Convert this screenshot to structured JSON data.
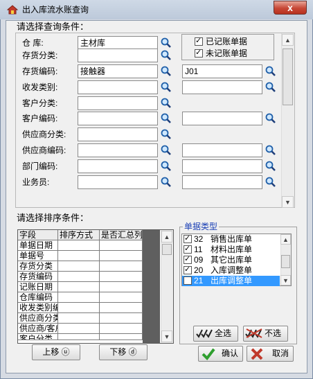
{
  "window": {
    "title": "出入库流水账查询",
    "close_symbol": "x"
  },
  "query": {
    "section_label": "请选择查询条件：",
    "rows": [
      {
        "label": "仓    库:",
        "value": "主材库",
        "value2": null
      },
      {
        "label": "存货分类:",
        "value": "",
        "value2": null
      },
      {
        "label": "存货编码:",
        "value": "接触器",
        "value2": "J01"
      },
      {
        "label": "收发类别:",
        "value": "",
        "value2": ""
      },
      {
        "label": "客户分类:",
        "value": "",
        "value2": null
      },
      {
        "label": "客户编码:",
        "value": "",
        "value2": ""
      },
      {
        "label": "供应商分类:",
        "value": "",
        "value2": null
      },
      {
        "label": "供应商编码:",
        "value": "",
        "value2": ""
      },
      {
        "label": "部门编码:",
        "value": "",
        "value2": ""
      },
      {
        "label": "业务员:",
        "value": "",
        "value2": ""
      }
    ],
    "status_checks": [
      {
        "label": "已记账单据",
        "checked": true
      },
      {
        "label": "未记账单据",
        "checked": true
      }
    ]
  },
  "sort": {
    "section_label": "请选择排序条件：",
    "columns": [
      "字段",
      "排序方式",
      "是否汇总列"
    ],
    "fields": [
      "单据日期",
      "单据号",
      "存货分类",
      "存货编码",
      "记账日期",
      "仓库编码",
      "收发类别编码",
      "供应商分类",
      "供应商/客户",
      "客户分类"
    ],
    "move_up_label": "上移 ⓤ",
    "move_down_label": "下移 ⓓ"
  },
  "doc_types": {
    "label": "单据类型",
    "items": [
      {
        "code": "32",
        "name": "销售出库单",
        "checked": true
      },
      {
        "code": "11",
        "name": "材料出库单",
        "checked": true
      },
      {
        "code": "09",
        "name": "其它出库单",
        "checked": true
      },
      {
        "code": "20",
        "name": "入库调整单",
        "checked": true
      },
      {
        "code": "21",
        "name": "出库调整单",
        "checked": true,
        "selected": true
      }
    ],
    "select_all_label": "全选",
    "deselect_label": "不选"
  },
  "actions": {
    "ok_label": "确认",
    "cancel_label": "取消"
  },
  "colors": {
    "selection": "#3399ff",
    "group_title": "#1a3fb4",
    "close_red": "#c74736"
  },
  "icons": [
    "home-icon",
    "search-icon",
    "checkmark-icon",
    "select-all-icon",
    "deselect-all-icon",
    "confirm-check-icon",
    "cancel-x-icon"
  ]
}
